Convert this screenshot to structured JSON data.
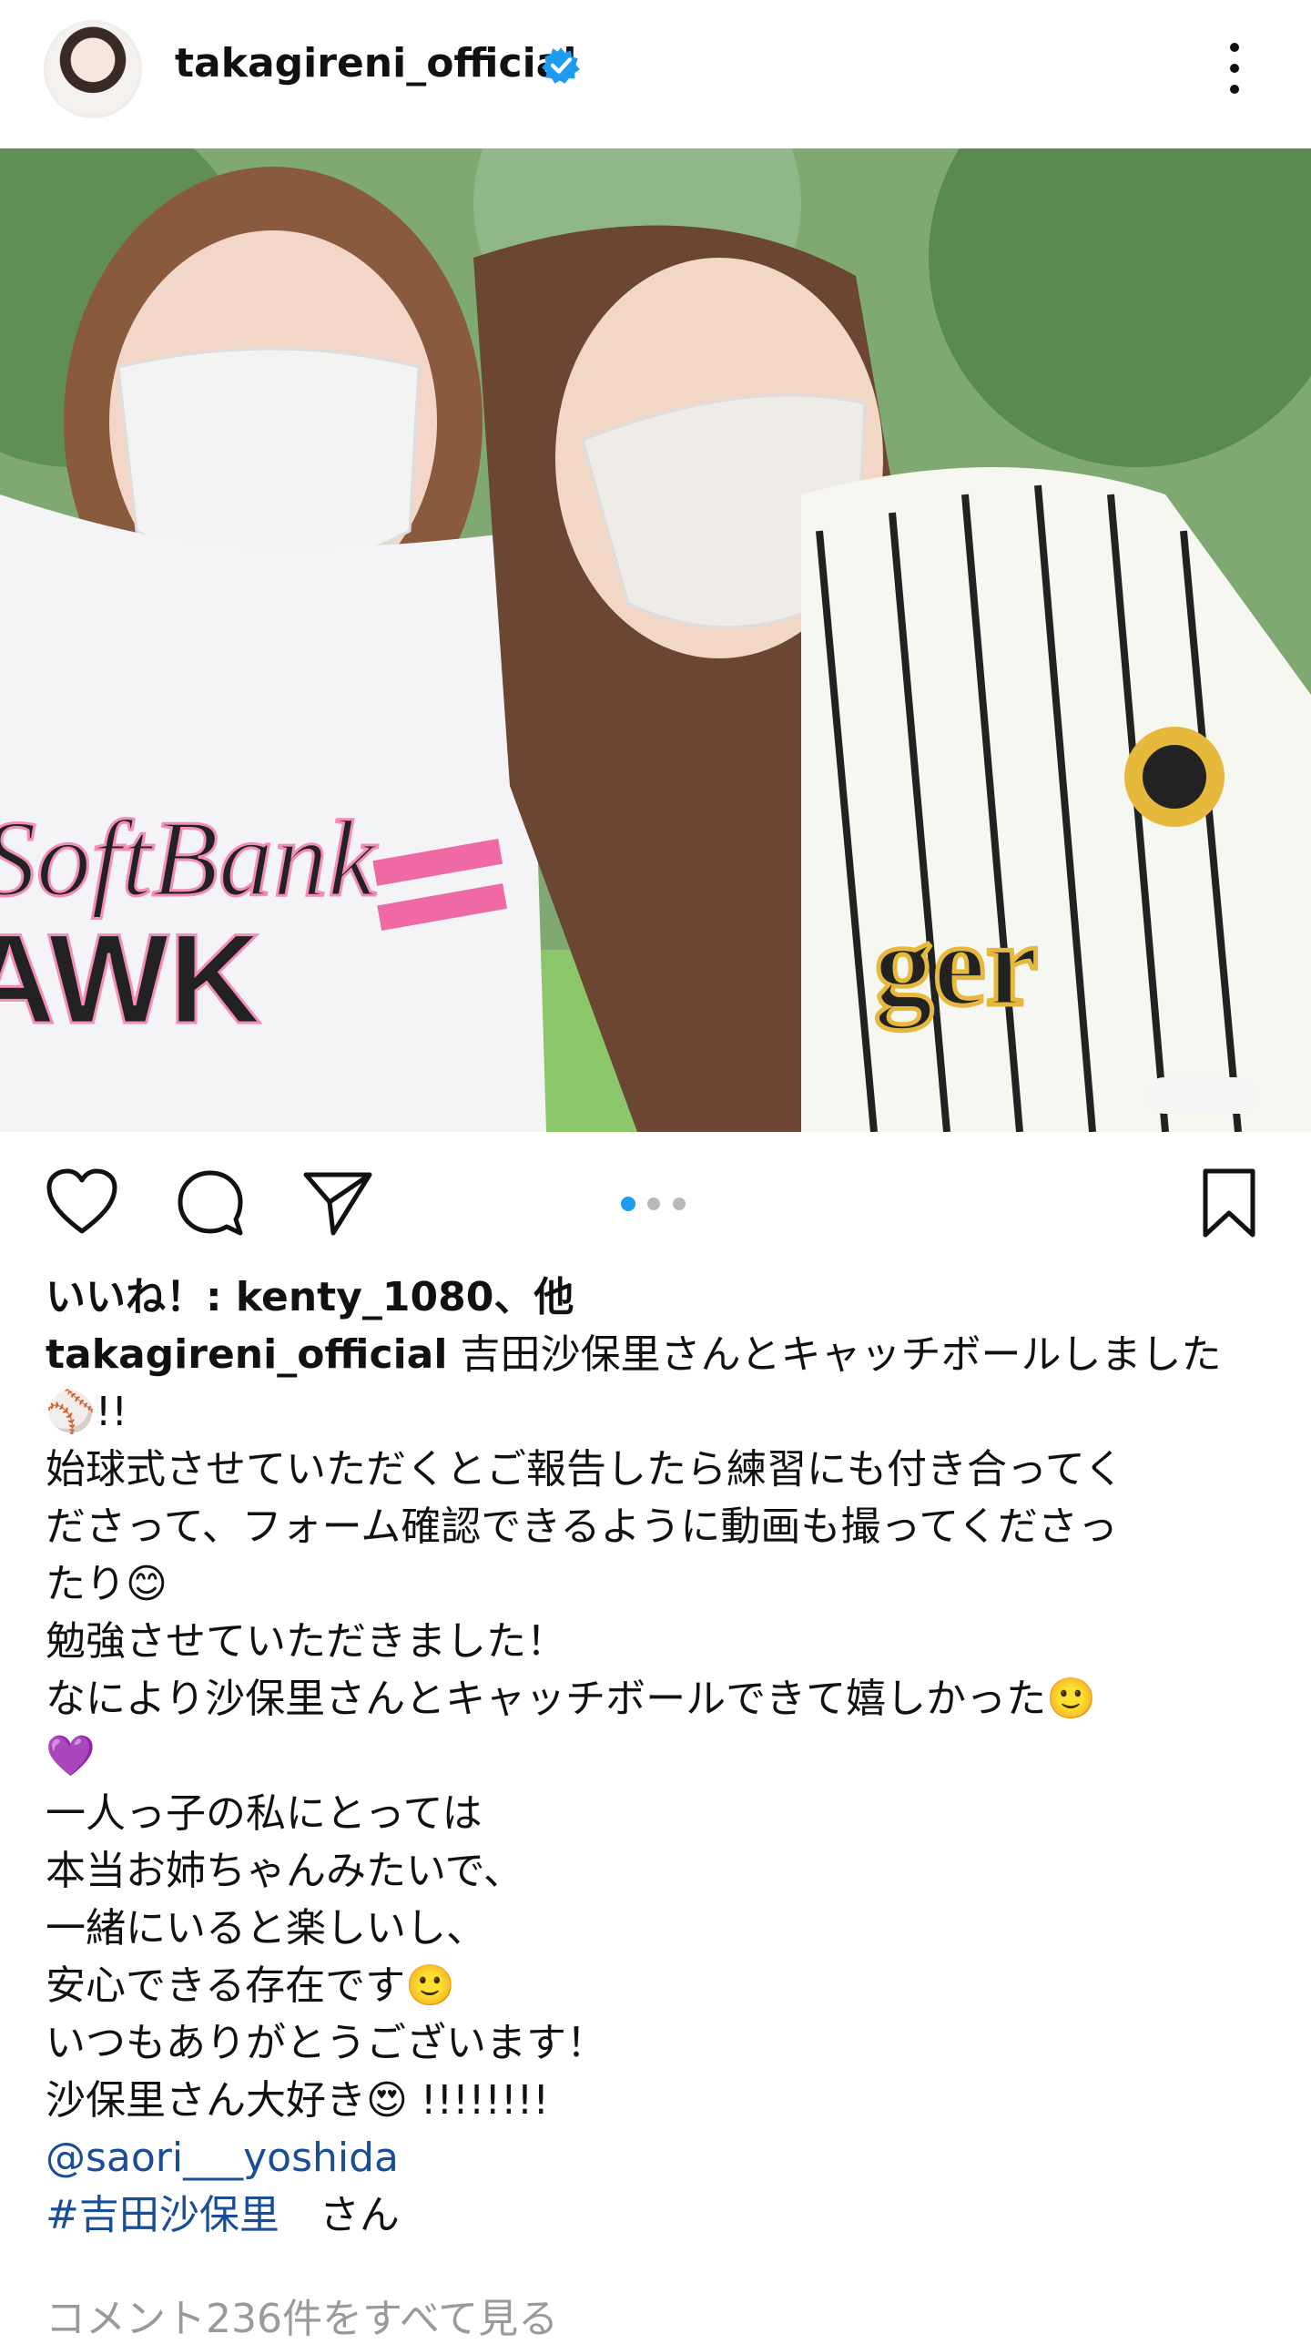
{
  "header": {
    "username": "takagireni_official",
    "avatar": "avatar",
    "verified": "verified-badge-icon",
    "menu": "more-vertical-icon"
  },
  "post": {
    "pager": {
      "count": 3,
      "active": 0
    }
  },
  "caption": {
    "likes_line": "いいね！: kenty_1080、他",
    "user": "takagireni_official",
    "line1_rest": " 吉田沙保里さんとキャッチボールしました",
    "line2": "⚾!!",
    "line3": "始球式させていただくとご報告したら練習にも付き合ってく",
    "line4": "ださって、フォーム確認できるように動画も撮ってくださっ",
    "line5": "たり😊",
    "line6": "勉強させていただきました！",
    "line7": "なにより沙保里さんとキャッチボールできて嬉しかった🙂",
    "line8": "💜",
    "line9": "一人っ子の私にとっては",
    "line10": "本当お姉ちゃんみたいで、",
    "line11": "一緒にいると楽しいし、",
    "line12": "安心できる存在です🙂",
    "line13": "いつもありがとうございます！",
    "line14": "沙保里さん大好き😍 !!!!!!!!",
    "mention": "@saori___yoshida",
    "hashtag": "#吉田沙保里",
    "hashtag_suffix": "　さん"
  },
  "view_comments": "コメント236件をすべて見る",
  "colors": {
    "blue": "#1d9bf0",
    "link": "#1a4d99",
    "muted": "#9a9a9a"
  }
}
